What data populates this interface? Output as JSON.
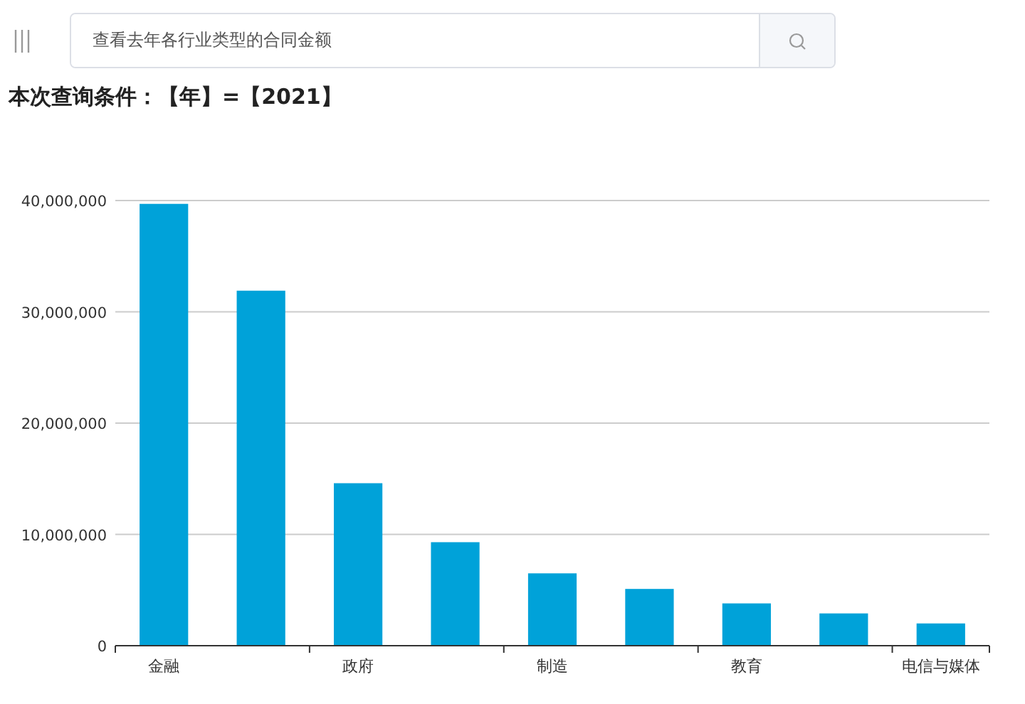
{
  "search": {
    "value": "查看去年各行业类型的合同金额"
  },
  "query_title": "本次查询条件：【年】=【2021】",
  "chart_data": {
    "type": "bar",
    "categories": [
      "金融",
      null,
      "政府",
      null,
      "制造",
      null,
      "教育",
      null,
      "电信与媒体"
    ],
    "grid": true,
    "series": [
      {
        "color": "#00a2d9",
        "values": [
          39700000,
          31900000,
          14600000,
          9300000,
          6500000,
          5100000,
          3800000,
          2900000,
          2000000
        ]
      }
    ],
    "ylim": [
      0,
      40000000
    ],
    "yticks": [
      {
        "value": 0,
        "label": "0"
      },
      {
        "value": 10000000,
        "label": "10,000,000"
      },
      {
        "value": 20000000,
        "label": "20,000,000"
      },
      {
        "value": 30000000,
        "label": "30,000,000"
      },
      {
        "value": 40000000,
        "label": "40,000,000"
      }
    ]
  }
}
